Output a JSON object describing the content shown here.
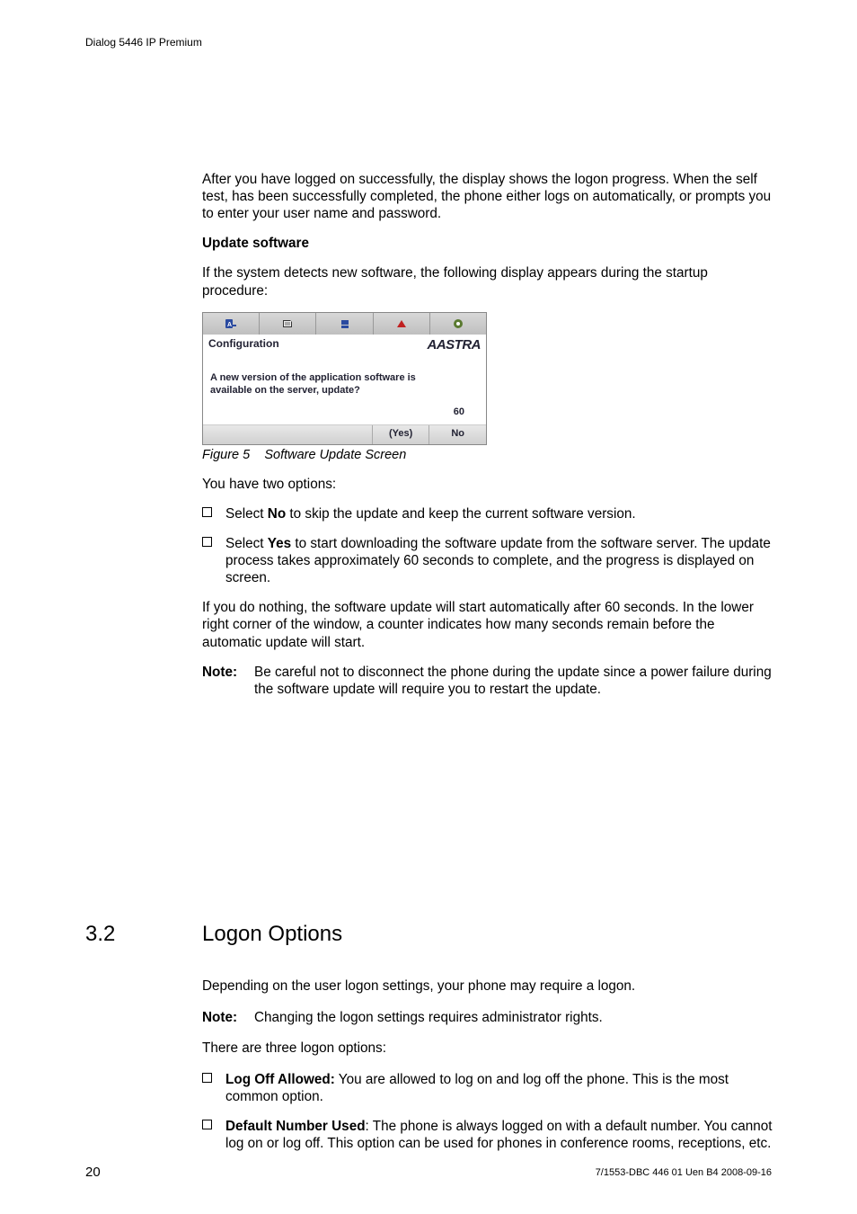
{
  "header": {
    "product": "Dialog 5446 IP Premium"
  },
  "intro": {
    "p1": "After you have logged on successfully, the display shows the logon progress. When the self test, has been successfully completed, the phone either logs on automatically, or prompts you to enter your user name and password.",
    "heading": "Update software",
    "p2": "If the system detects new software, the following display appears during the startup procedure:"
  },
  "phone": {
    "config_label": "Configuration",
    "brand": "AASTRA",
    "msg_line1": "A new version of the application software is",
    "msg_line2": "available on the server, update?",
    "counter": "60",
    "btn_yes": "(Yes)",
    "btn_no": "No",
    "tab_icons": [
      "phone",
      "contacts",
      "callhist",
      "camera",
      "gear"
    ]
  },
  "figure": {
    "label": "Figure 5",
    "title": "Software Update Screen"
  },
  "options": {
    "lead": "You have two options:",
    "item1_pre": "Select ",
    "item1_bold": "No",
    "item1_post": " to skip the update and keep the current software version.",
    "item2_pre": "Select ",
    "item2_bold": "Yes",
    "item2_post": " to start downloading the software update from the software server. The update process takes approximately 60 seconds to complete, and the progress is displayed on screen.",
    "p3": "If you do nothing, the software update will start automatically after 60 seconds. In the lower right corner of the window, a counter indicates how many seconds remain before the automatic update will start.",
    "note_label": "Note:",
    "note_body": "Be careful not to disconnect the phone during the update since a power failure during the software update will require you to restart the update."
  },
  "section": {
    "num": "3.2",
    "title": "Logon Options",
    "p1": "Depending on the user logon settings, your phone may require a logon.",
    "note_label": "Note:",
    "note_body": "Changing the logon settings requires administrator rights.",
    "p2": "There are three logon options:",
    "b1_label": "Log Off Allowed:",
    "b1_text": " You are allowed to log on and log off the phone. This is the most common option.",
    "b2_label": "Default Number Used",
    "b2_text": ": The phone is always logged on with a default number. You cannot log on or log off. This option can be used for phones in conference rooms, receptions, etc."
  },
  "footer": {
    "page": "20",
    "docid": "7/1553-DBC 446 01 Uen B4  2008-09-16"
  }
}
